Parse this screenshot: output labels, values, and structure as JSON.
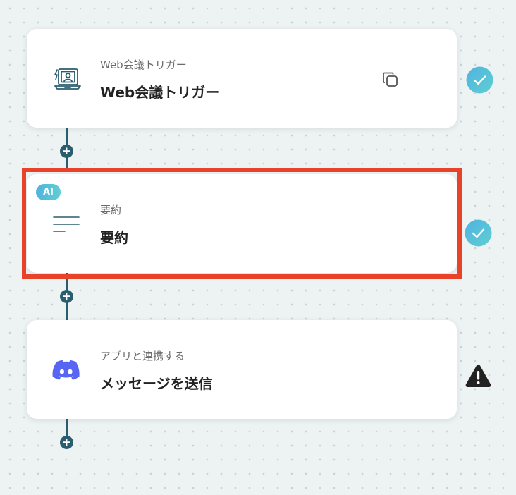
{
  "steps": [
    {
      "subtitle": "Web会議トリガー",
      "title": "Web会議トリガー",
      "icon": "web-meeting-trigger-icon",
      "status": "complete"
    },
    {
      "badge": "AI",
      "subtitle": "要約",
      "title": "要約",
      "icon": "text-lines-icon",
      "status": "complete"
    },
    {
      "subtitle": "アプリと連携する",
      "title": "メッセージを送信",
      "icon": "discord-icon",
      "status": "warning"
    }
  ],
  "add_step_label": "+",
  "colors": {
    "connector": "#2a5d6e",
    "highlight": "#e8432a",
    "check_gradient_start": "#4fb3e0",
    "check_gradient_end": "#5fcfd2",
    "discord": "#5865f2",
    "warning": "#222222"
  }
}
